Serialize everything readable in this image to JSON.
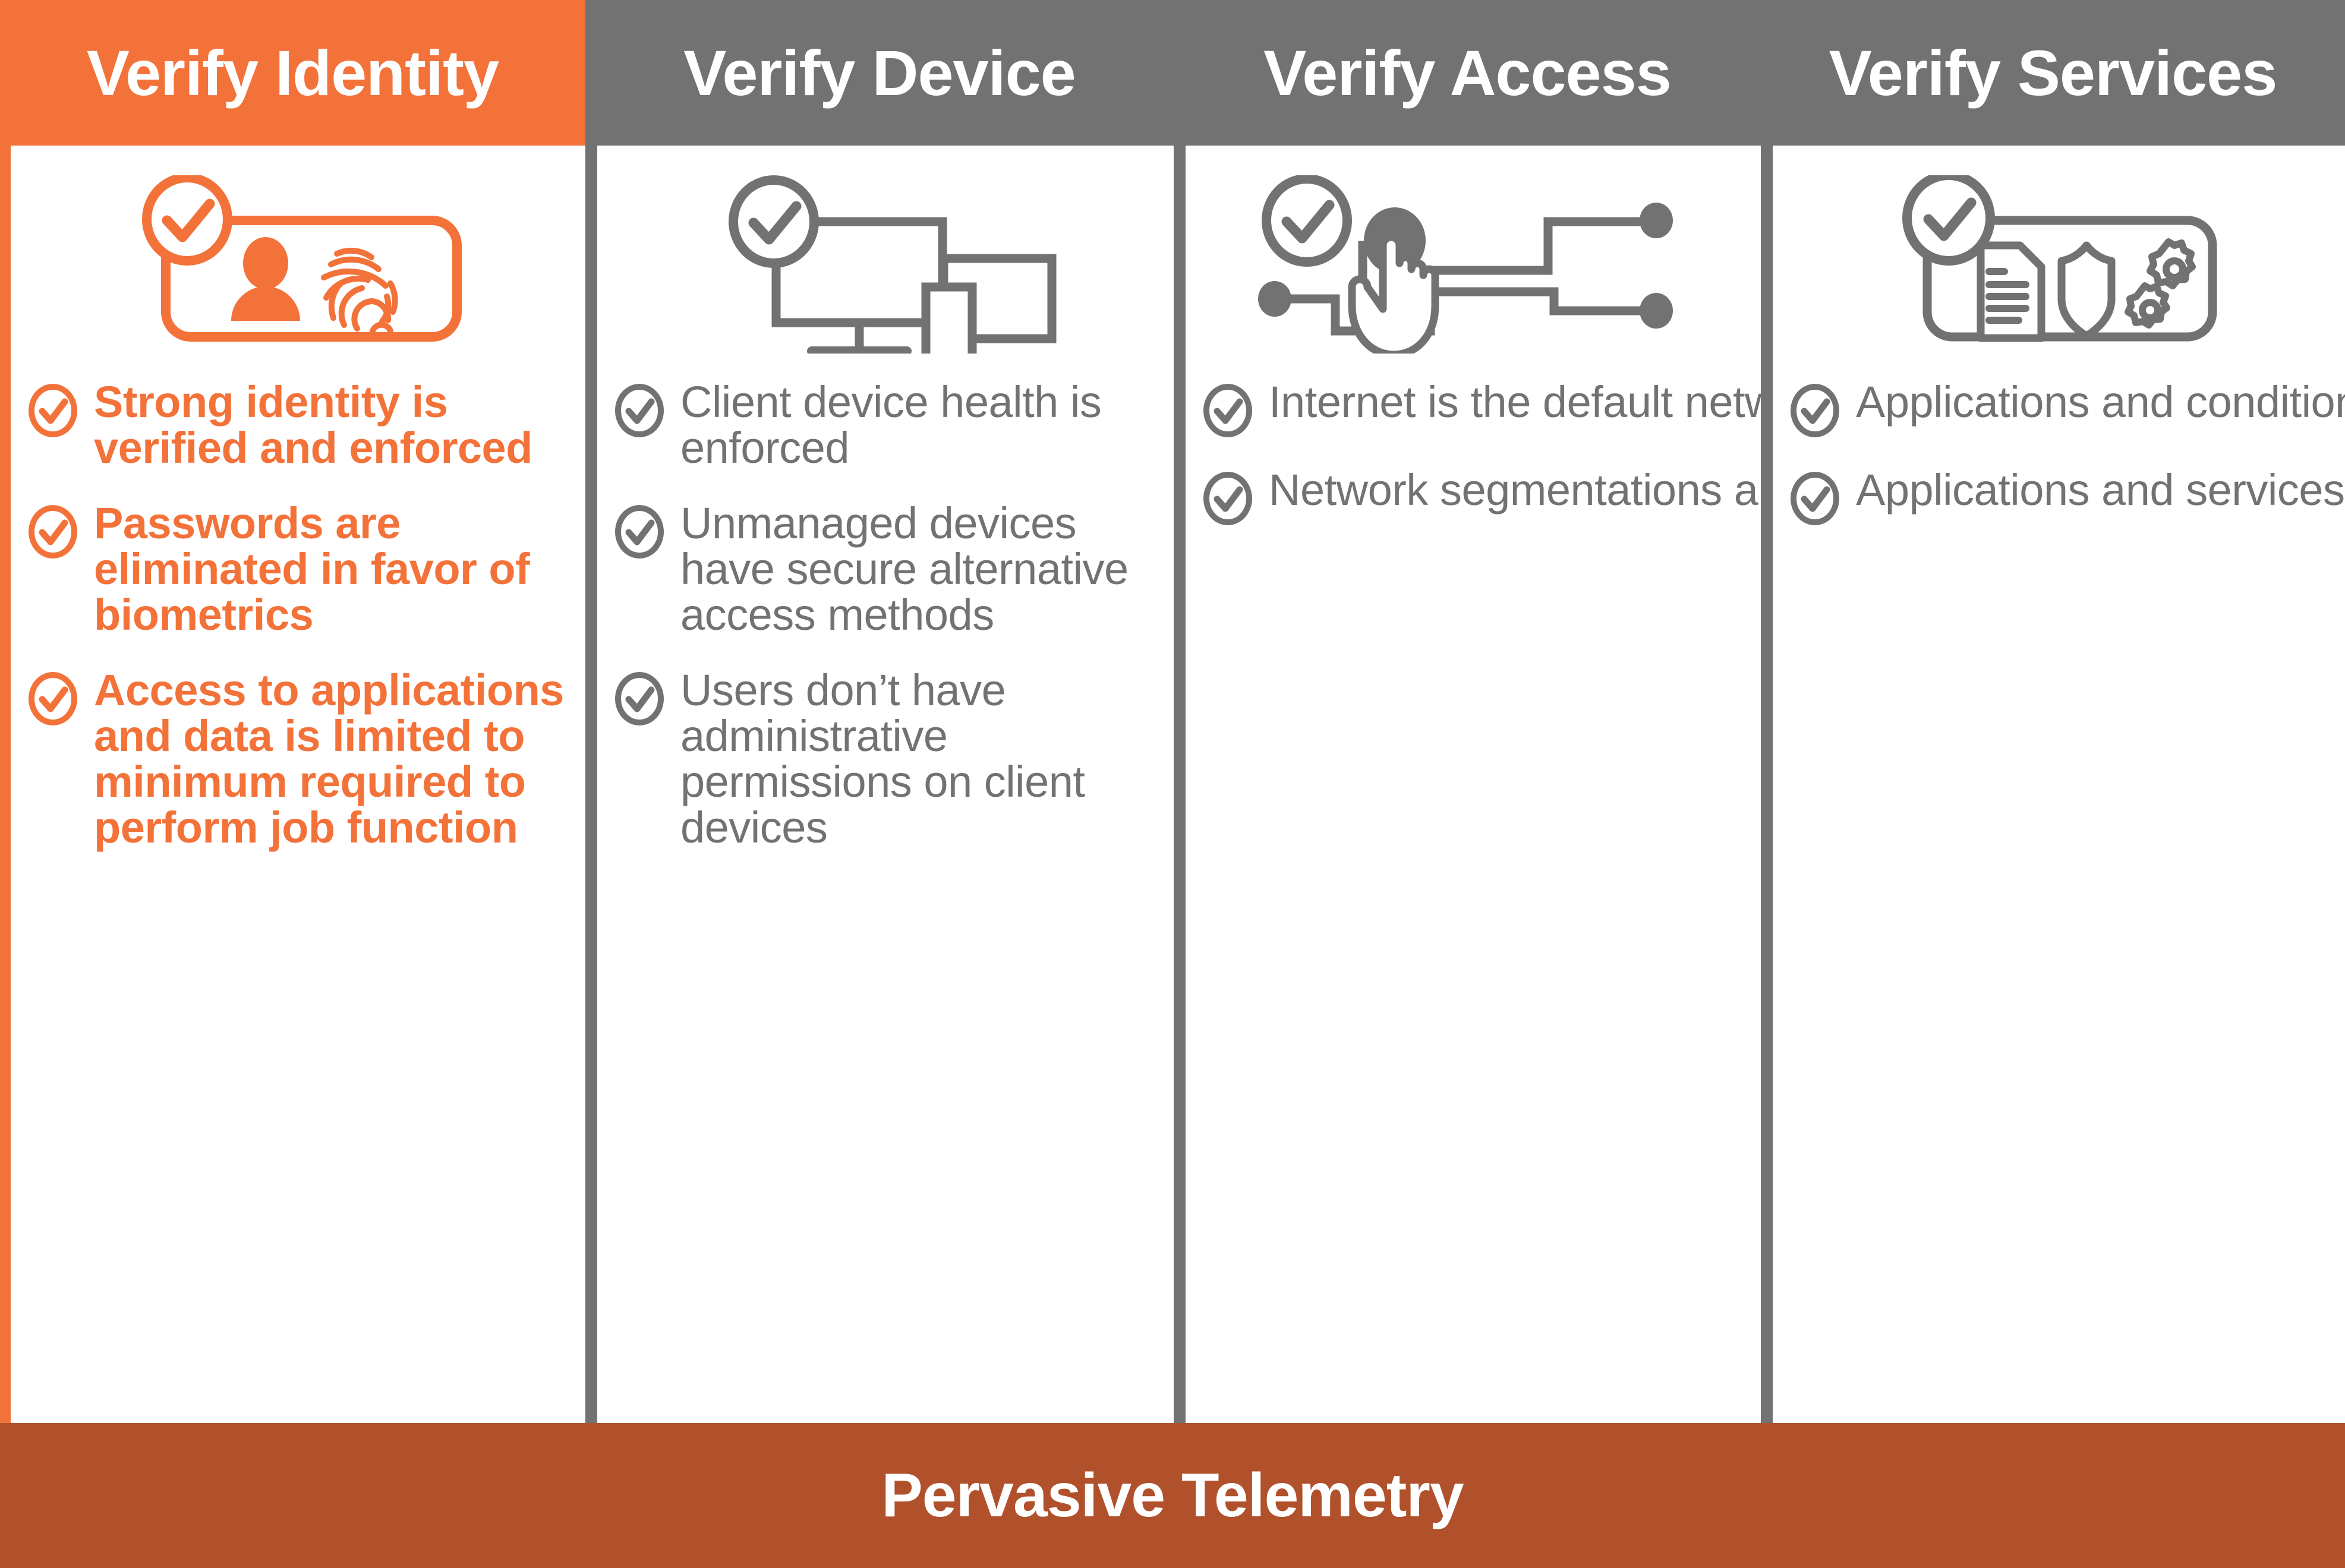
{
  "headers": [
    {
      "label": "Verify Identity",
      "bg": "#F37239",
      "active": true
    },
    {
      "label": "Verify Device",
      "bg": "#727272",
      "active": false
    },
    {
      "label": "Verify Access",
      "bg": "#727272",
      "active": false
    },
    {
      "label": "Verify Services",
      "bg": "#727272",
      "active": false
    }
  ],
  "columns": [
    {
      "key": "identity",
      "icon_name": "id-badge-fingerprint-icon",
      "accent": "#F37239",
      "bullets": [
        "Strong identity is verified and enforced",
        "Passwords are eliminated in favor of biometrics",
        "Access to applications and data is limited to minimum required to perform job function"
      ]
    },
    {
      "key": "device",
      "icon_name": "monitor-tablet-phone-icon",
      "accent": "#727272",
      "bullets": [
        "Client device health is enforced",
        "Unmanaged devices have secure alternative access methods",
        "Users don’t have administrative permissions on client devices"
      ]
    },
    {
      "key": "access",
      "icon_name": "network-nodes-hand-pointer-icon",
      "accent": "#727272",
      "bullets": [
        "Internet is the default network in all Microsoft Office locations",
        "Network segmentations are built based on role and function"
      ]
    },
    {
      "key": "services",
      "icon_name": "document-shield-gears-card-icon",
      "accent": "#727272",
      "bullets": [
        "Applications and conditions are enforced using conditional access",
        "Applications and services are accessible directly from the internet"
      ]
    }
  ],
  "footer": {
    "label": "Pervasive Telemetry",
    "bg": "#B0512C"
  },
  "colors": {
    "orange": "#F37239",
    "gray": "#727272",
    "rust": "#B0512C",
    "white": "#FFFFFF"
  }
}
